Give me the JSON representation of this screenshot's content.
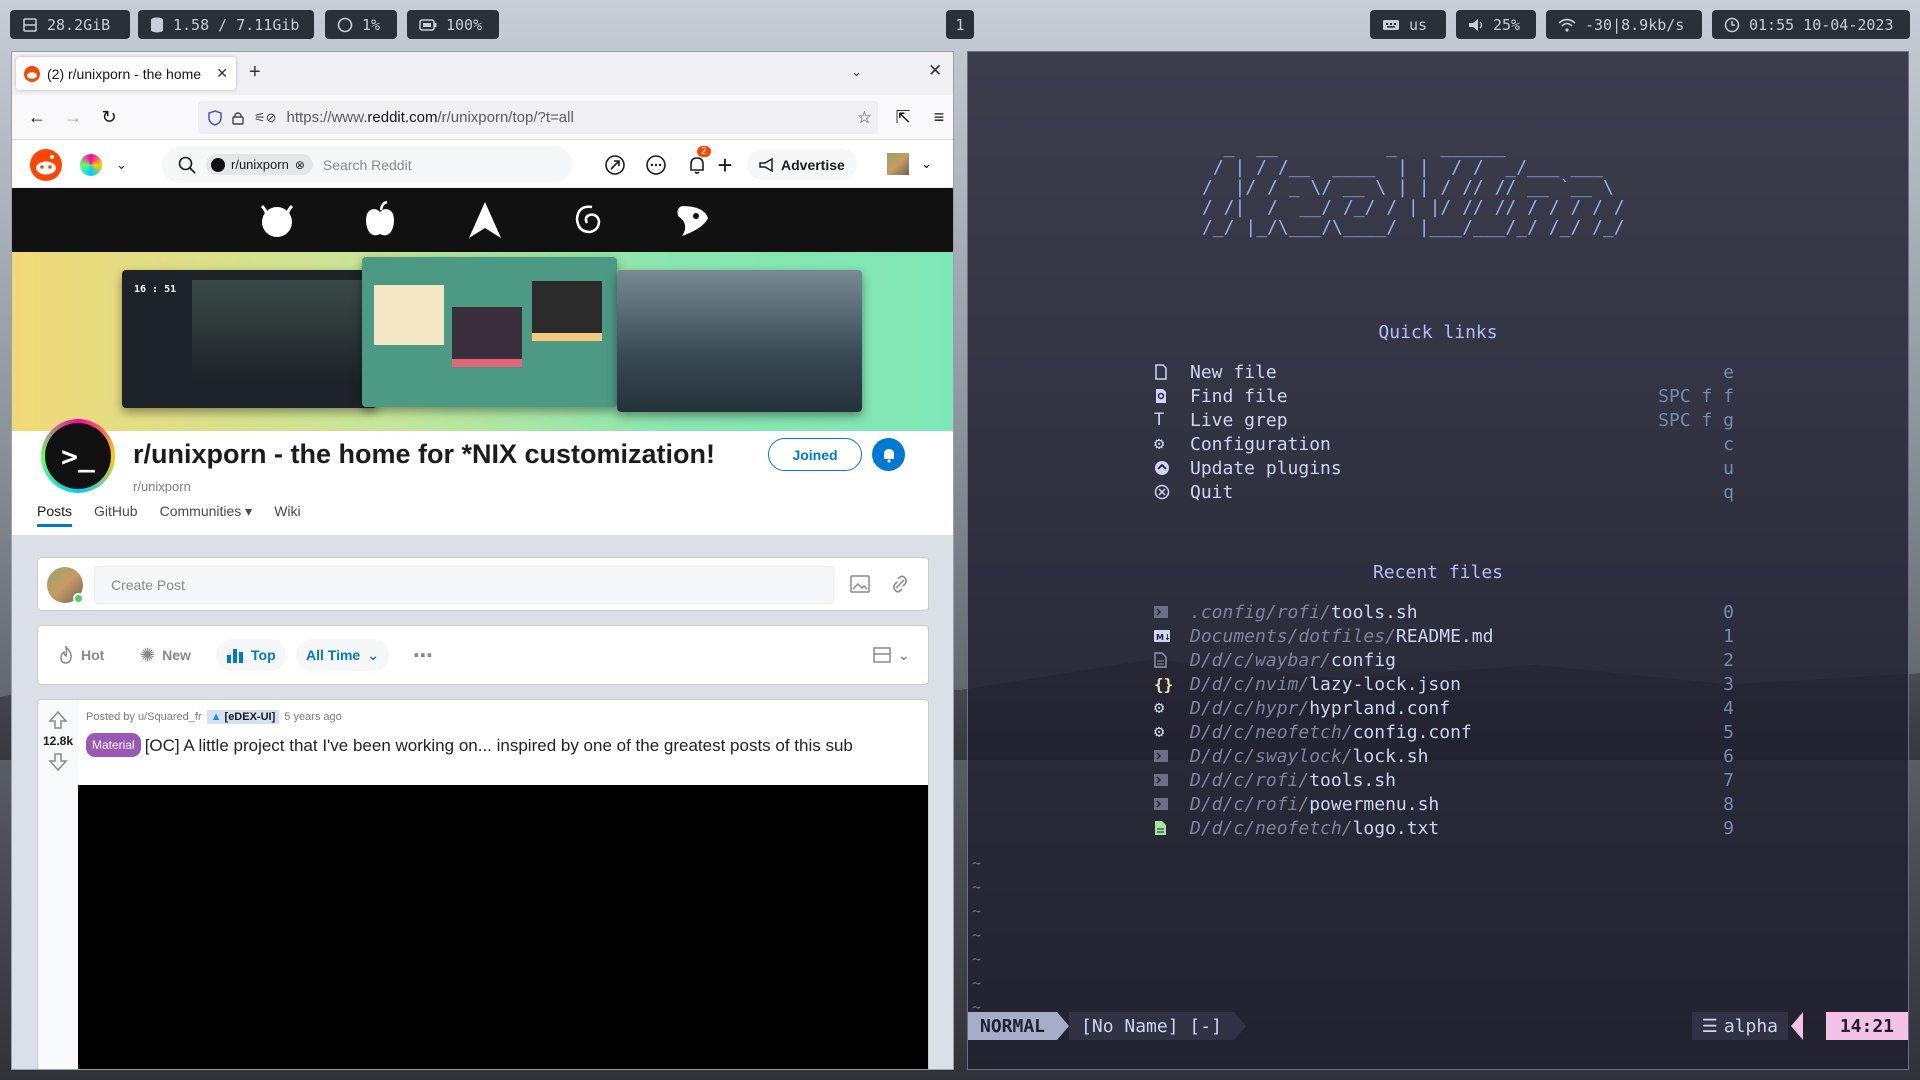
{
  "waybar": {
    "disk": "28.2GiB",
    "memory": "1.58 / 7.11Gib",
    "cpu": "1%",
    "battery": "100%",
    "workspace": "1",
    "keyboard": "us",
    "volume": "25%",
    "network": "-30|8.9kb/s",
    "clock": "01:55 10-04-2023"
  },
  "browser": {
    "tab_title": "(2) r/unixporn - the home",
    "url_prefix": "https://www.",
    "url_domain": "reddit.com",
    "url_path": "/r/unixporn/top/?t=all"
  },
  "reddit": {
    "community_chip": "r/unixporn",
    "search_placeholder": "Search Reddit",
    "notification_count": "2",
    "advertise_label": "Advertise",
    "sub_title": "r/unixporn - the home for *NIX customization!",
    "sub_name": "r/unixporn",
    "joined_label": "Joined",
    "tabs": [
      "Posts",
      "GitHub",
      "Communities",
      "Wiki"
    ],
    "create_post_placeholder": "Create Post",
    "sort": {
      "hot": "Hot",
      "new": "New",
      "top": "Top",
      "time": "All Time"
    },
    "post": {
      "posted_by": "Posted by u/Squared_fr",
      "user_flair": "[eDEX-UI]",
      "age": "5 years ago",
      "votes": "12.8k",
      "tag": "Material",
      "title": "[OC] A little project that I've been working on... inspired by one of the greatest posts of this sub"
    },
    "banner_clock": "16 : 51"
  },
  "nvim": {
    "ascii_art": "  _  __          _    ______\n / | / /__  ____  | |  / /  _/___ ___\n/  |/ / _ \\/ __ \\ | | / // // __ `__ \\\n/ /|  /  __/ /_/ / | |/ // // / / / / /\n/_/ |_/\\___/\\____/  |___/___/_/ /_/ /_/",
    "quick_links_title": "Quick links",
    "quick_links": [
      {
        "label": "New file",
        "key": "e",
        "icon": "file-icon"
      },
      {
        "label": "Find file",
        "key": "SPC f f",
        "icon": "find-file-icon"
      },
      {
        "label": "Live grep",
        "key": "SPC f g",
        "icon": "text-icon"
      },
      {
        "label": "Configuration",
        "key": "c",
        "icon": "gear-icon"
      },
      {
        "label": "Update plugins",
        "key": "u",
        "icon": "upload-icon"
      },
      {
        "label": "Quit",
        "key": "q",
        "icon": "close-circle-icon"
      }
    ],
    "recent_title": "Recent files",
    "recent_files": [
      {
        "dir": ".config/rofi/",
        "file": "tools.sh",
        "key": "0",
        "icon": "terminal-icon"
      },
      {
        "dir": "Documents/dotfiles/",
        "file": "README.md",
        "key": "1",
        "icon": "markdown-icon"
      },
      {
        "dir": "D/d/c/waybar/",
        "file": "config",
        "key": "2",
        "icon": "file-text-icon"
      },
      {
        "dir": "D/d/c/nvim/",
        "file": "lazy-lock.json",
        "key": "3",
        "icon": "json-icon"
      },
      {
        "dir": "D/d/c/hypr/",
        "file": "hyprland.conf",
        "key": "4",
        "icon": "gear-icon"
      },
      {
        "dir": "D/d/c/neofetch/",
        "file": "config.conf",
        "key": "5",
        "icon": "gear-icon"
      },
      {
        "dir": "D/d/c/swaylock/",
        "file": "lock.sh",
        "key": "6",
        "icon": "terminal-icon"
      },
      {
        "dir": "D/d/c/rofi/",
        "file": "tools.sh",
        "key": "7",
        "icon": "terminal-icon"
      },
      {
        "dir": "D/d/c/rofi/",
        "file": "powermenu.sh",
        "key": "8",
        "icon": "terminal-icon"
      },
      {
        "dir": "D/d/c/neofetch/",
        "file": "logo.txt",
        "key": "9",
        "icon": "text-file-icon"
      }
    ],
    "mode": "NORMAL",
    "buffer": "[No Name] [-]",
    "filetype": "alpha",
    "position": "14:21",
    "colors": {
      "accent": "#89b4fa",
      "mode_bg": "#a6adc8",
      "pos_bg": "#f5c2e7"
    }
  }
}
